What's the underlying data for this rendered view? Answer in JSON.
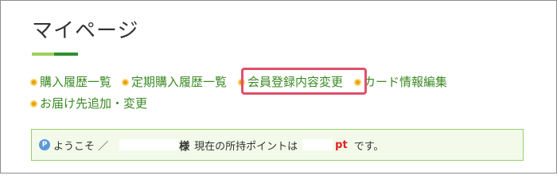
{
  "header": {
    "page_title": "マイページ",
    "underline_colors": [
      "#9fd05a",
      "#2f8f2f"
    ]
  },
  "nav": {
    "bullet_color": "#f2a900",
    "link_color": "#3b8a24",
    "items": [
      {
        "label": "購入履歴一覧"
      },
      {
        "label": "定期購入履歴一覧"
      },
      {
        "label": "会員登録内容変更",
        "highlighted": true
      },
      {
        "label": "カード情報編集"
      },
      {
        "label": "お届け先追加・変更"
      }
    ],
    "highlight_color": "#e0516a"
  },
  "points": {
    "icon_letter": "P",
    "welcome": "ようこそ ／",
    "sama": "様",
    "current_label": "現在の所持ポイントは",
    "unit": "pt",
    "suffix": "です。",
    "unit_color": "#e02020"
  }
}
